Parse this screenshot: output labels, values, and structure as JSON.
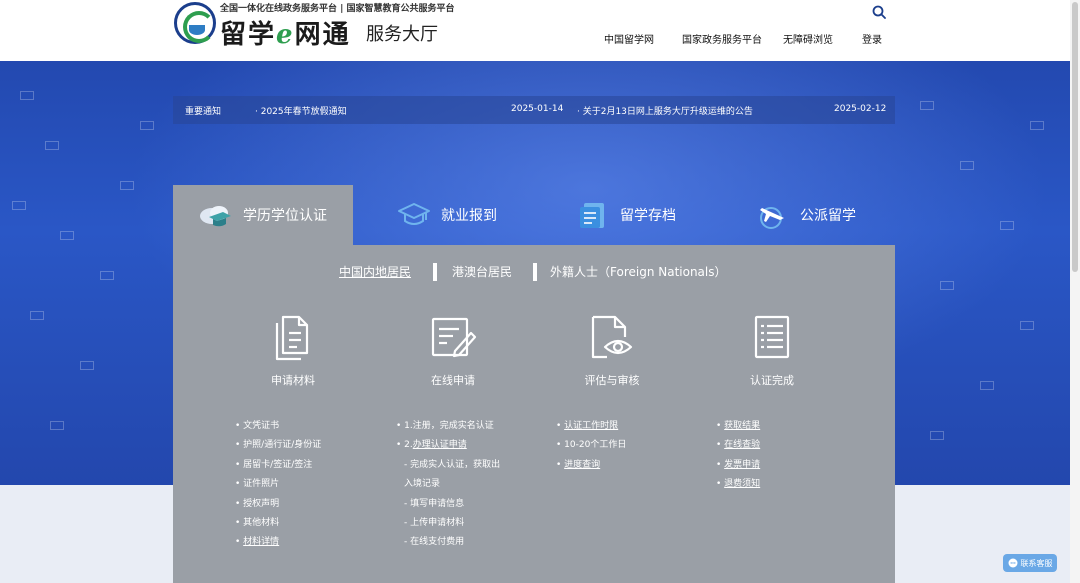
{
  "header": {
    "logo_top": "全国一体化在线政务服务平台 | 国家智慧教育公共服务平台",
    "logo_main_a": "留学",
    "logo_main_e": "e",
    "logo_main_b": "网通",
    "logo_sub": "服务大厅",
    "nav": [
      "中国留学网",
      "国家政务服务平台",
      "无障碍浏览",
      "登录"
    ],
    "search_icon": "search-icon"
  },
  "notice": {
    "label": "重要通知",
    "items": [
      {
        "text": "· 2025年春节放假通知",
        "date": "2025-01-14"
      },
      {
        "text": "· 关于2月13日网上服务大厅升级运维的公告",
        "date": "2025-02-12"
      }
    ]
  },
  "tabs": [
    {
      "label": "学历学位认证",
      "icon": "graduation-cloud-icon"
    },
    {
      "label": "就业报到",
      "icon": "graduation-cap-icon"
    },
    {
      "label": "留学存档",
      "icon": "archive-document-icon"
    },
    {
      "label": "公派留学",
      "icon": "airplane-globe-icon"
    }
  ],
  "subtabs": [
    "中国内地居民",
    "港澳台居民",
    "外籍人士（Foreign Nationals）"
  ],
  "steps": [
    {
      "label": "申请材料",
      "icon": "documents-icon",
      "items": [
        {
          "text": "• 文凭证书",
          "link": false
        },
        {
          "text": "• 护照/通行证/身份证",
          "link": false
        },
        {
          "text": "• 居留卡/签证/签注",
          "link": false
        },
        {
          "text": "• 证件照片",
          "link": false
        },
        {
          "text": "• 授权声明",
          "link": false
        },
        {
          "text": "• 其他材料",
          "link": false
        },
        {
          "text": "材料详情",
          "link": true,
          "bullet": "• "
        }
      ]
    },
    {
      "label": "在线申请",
      "icon": "edit-form-icon",
      "items": [
        {
          "text": "• 1.注册，完成实名认证",
          "link": false
        },
        {
          "text": "办理认证申请",
          "link": true,
          "bullet": "• 2."
        },
        {
          "text": "- 完成实人认证，获取出",
          "link": false,
          "sub": true
        },
        {
          "text": "入境记录",
          "link": false,
          "sub": true,
          "indentOnly": true
        },
        {
          "text": "- 填写申请信息",
          "link": false,
          "sub": true
        },
        {
          "text": "- 上传申请材料",
          "link": false,
          "sub": true
        },
        {
          "text": "- 在线支付费用",
          "link": false,
          "sub": true
        }
      ]
    },
    {
      "label": "评估与审核",
      "icon": "document-eye-icon",
      "items": [
        {
          "text": "认证工作时限",
          "link": true,
          "bullet": "• "
        },
        {
          "text": "• 10-20个工作日",
          "link": false
        },
        {
          "text": "进度查询",
          "link": true,
          "bullet": "• "
        }
      ]
    },
    {
      "label": "认证完成",
      "icon": "checklist-icon",
      "items": [
        {
          "text": "获取结果",
          "link": true,
          "bullet": "• "
        },
        {
          "text": "在线查验",
          "link": true,
          "bullet": "• "
        },
        {
          "text": "发票申请",
          "link": true,
          "bullet": "• "
        },
        {
          "text": "退费须知",
          "link": true,
          "bullet": "• "
        }
      ]
    }
  ],
  "chat": {
    "label": "联系客服",
    "icon": "chat-icon"
  }
}
